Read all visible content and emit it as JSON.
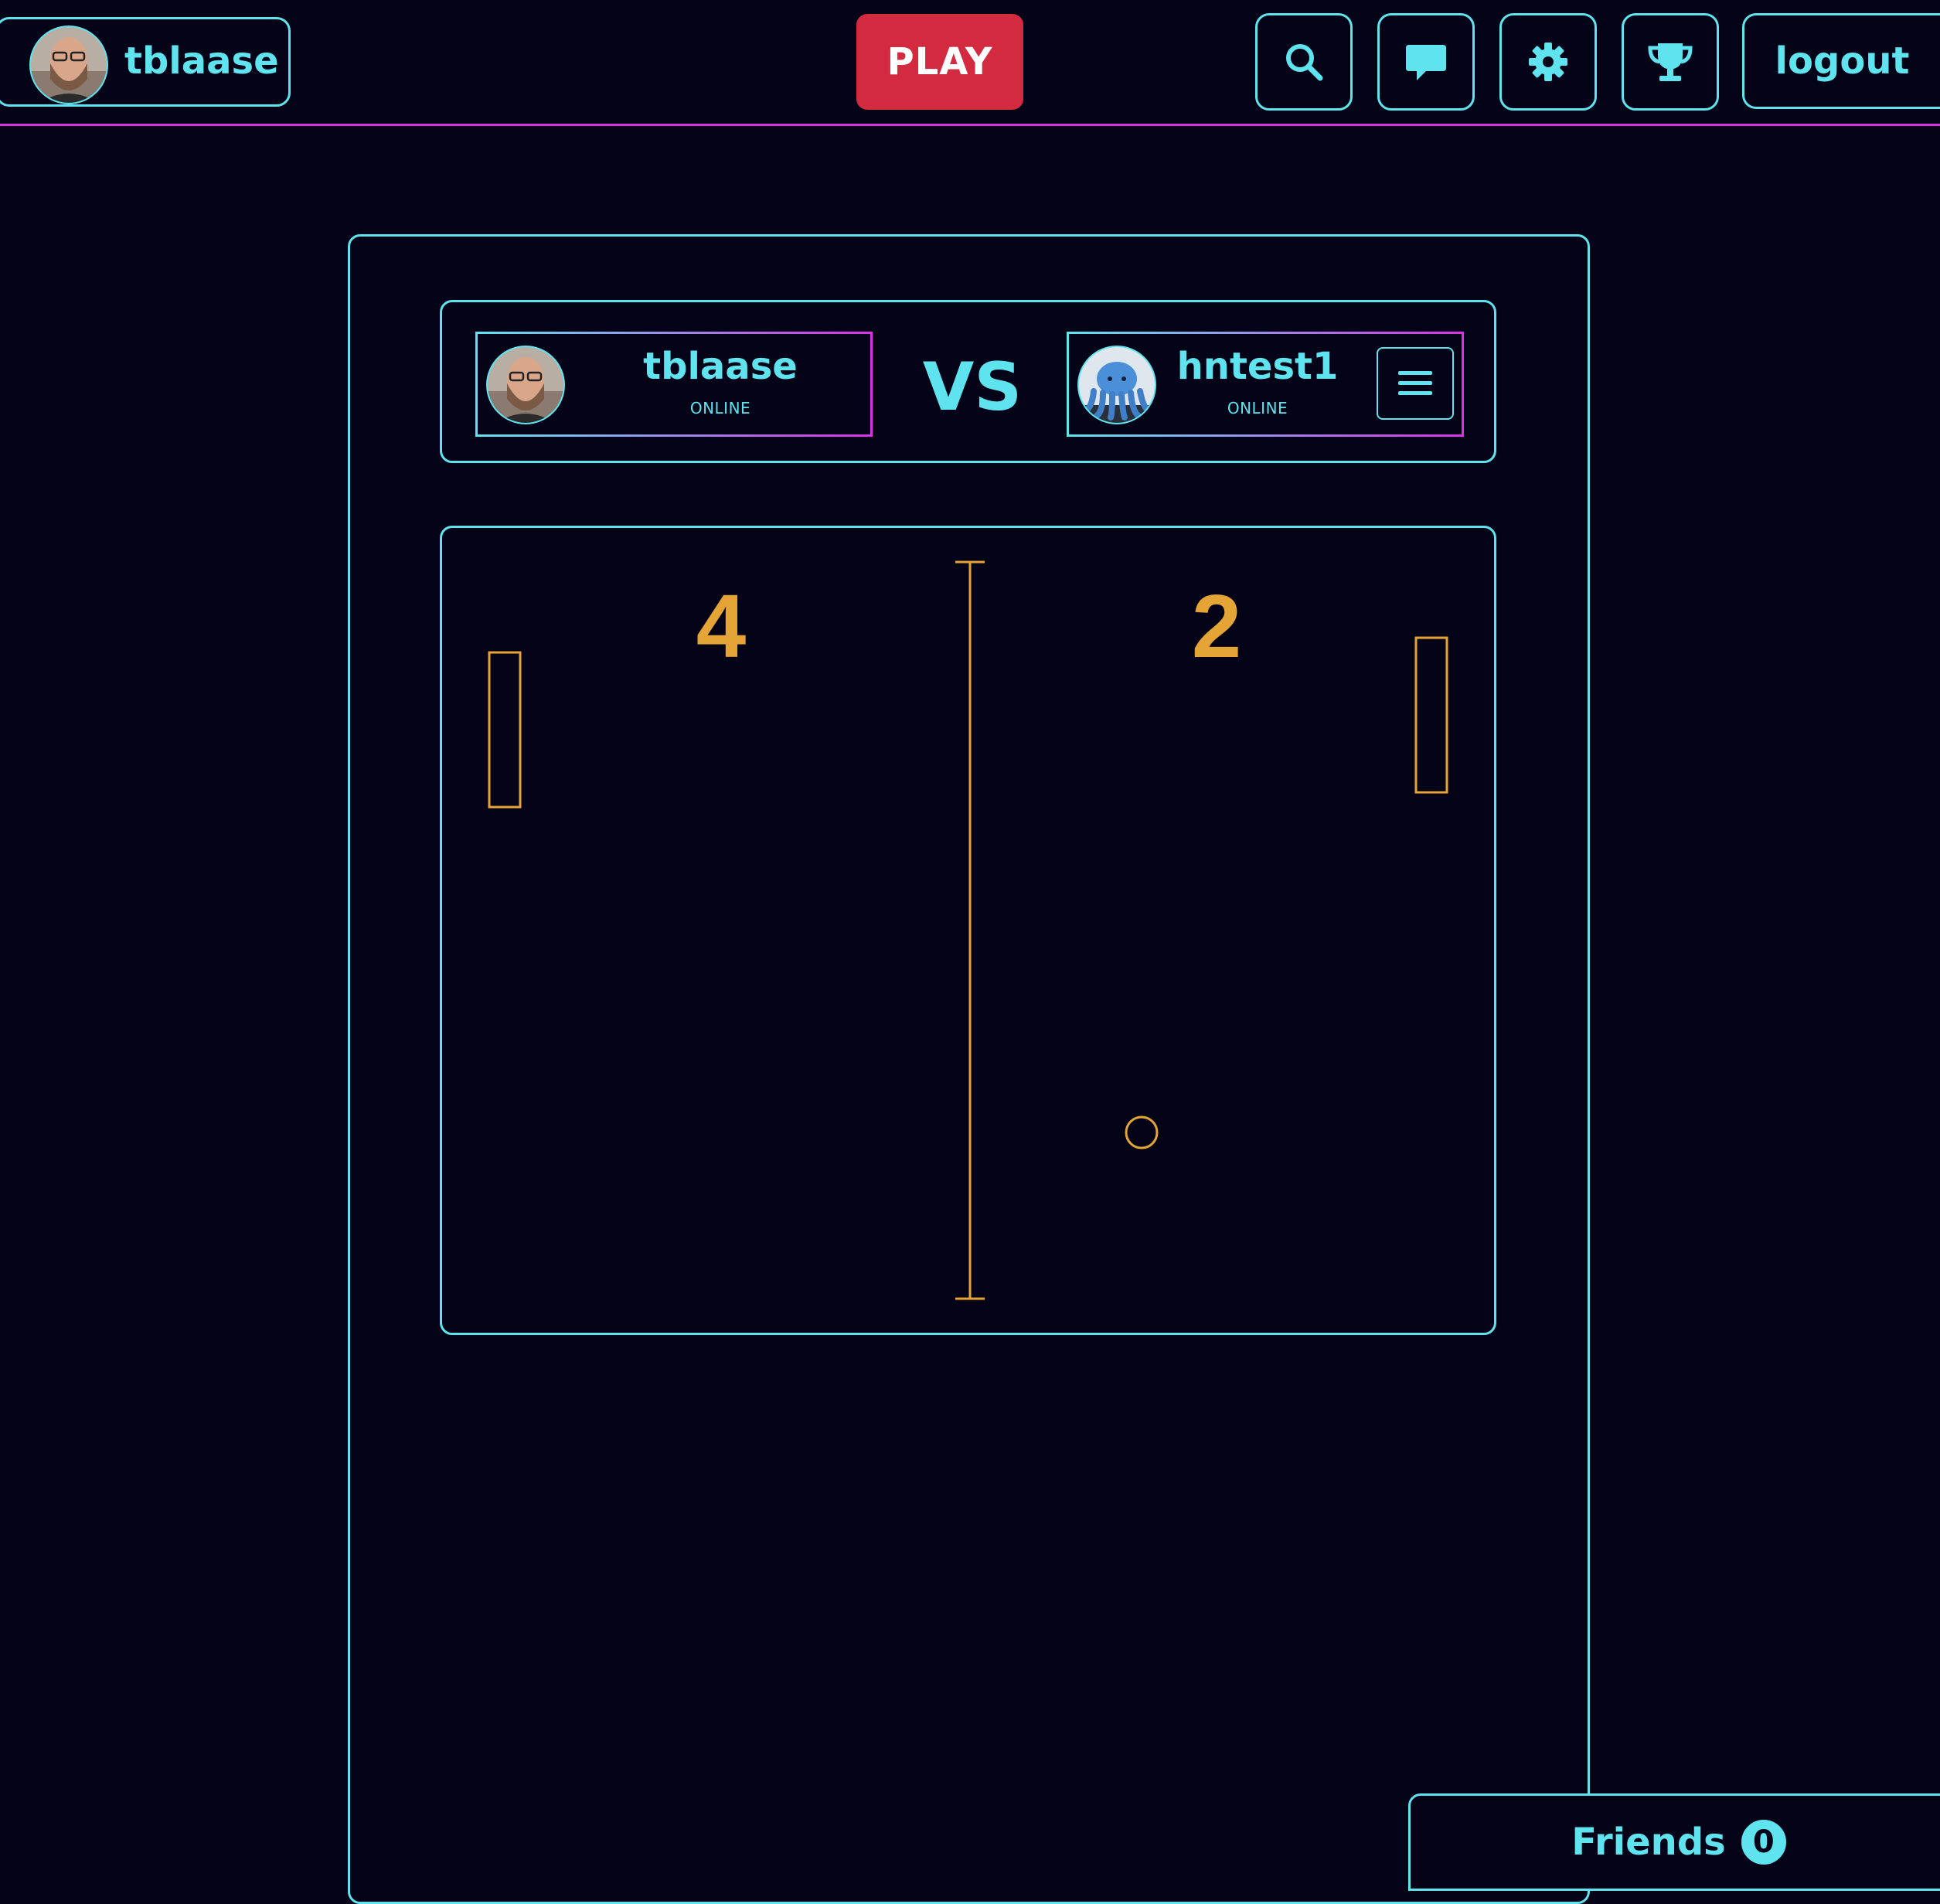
{
  "header": {
    "username": "tblaase",
    "play_label": "PLAY",
    "logout_label": "logout",
    "icons": [
      "search-icon",
      "chat-icon",
      "gear-icon",
      "trophy-icon"
    ]
  },
  "match": {
    "vs_label": "VS",
    "player1": {
      "name": "tblaase",
      "status": "ONLINE"
    },
    "player2": {
      "name": "hntest1",
      "status": "ONLINE"
    }
  },
  "game": {
    "score_left": "4",
    "score_right": "2"
  },
  "friends": {
    "label": "Friends",
    "count": "0"
  },
  "colors": {
    "background": "#050317",
    "accent": "#5fe4ef",
    "magenta": "#d932e6",
    "play": "#d22a3e",
    "game": "#e4a536"
  }
}
